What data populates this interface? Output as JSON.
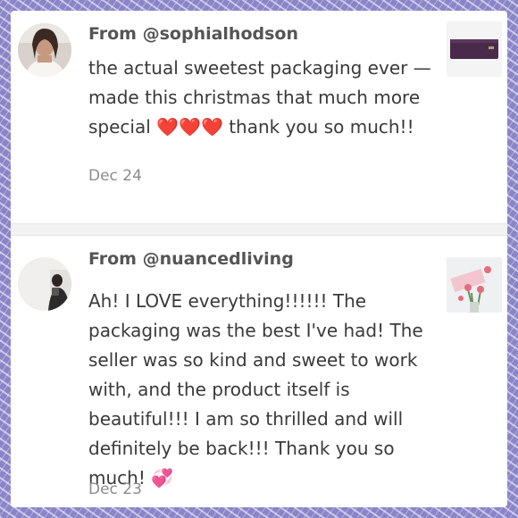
{
  "reviews": [
    {
      "from": "From @sophialhodson",
      "text": "the actual sweetest packaging ever —made this christmas that much more special ❤️❤️❤️ thank you so much!!",
      "date": "Dec 24"
    },
    {
      "from": "From @nuancedliving",
      "text": "Ah! I LOVE everything!!!!!! The packaging was the best I've had! The seller was so kind and sweet to work with, and the product itself is beautiful!!! I am so thrilled and will definitely be back!!! Thank you so much! 💞",
      "date": "Dec 23"
    }
  ],
  "colors": {
    "border_pattern": "#8a84c8",
    "card_bg": "#ffffff",
    "username": "#555555",
    "body_text": "#3a3a3a",
    "date": "#8c8c8c",
    "wallet": "#4a2a4a"
  }
}
